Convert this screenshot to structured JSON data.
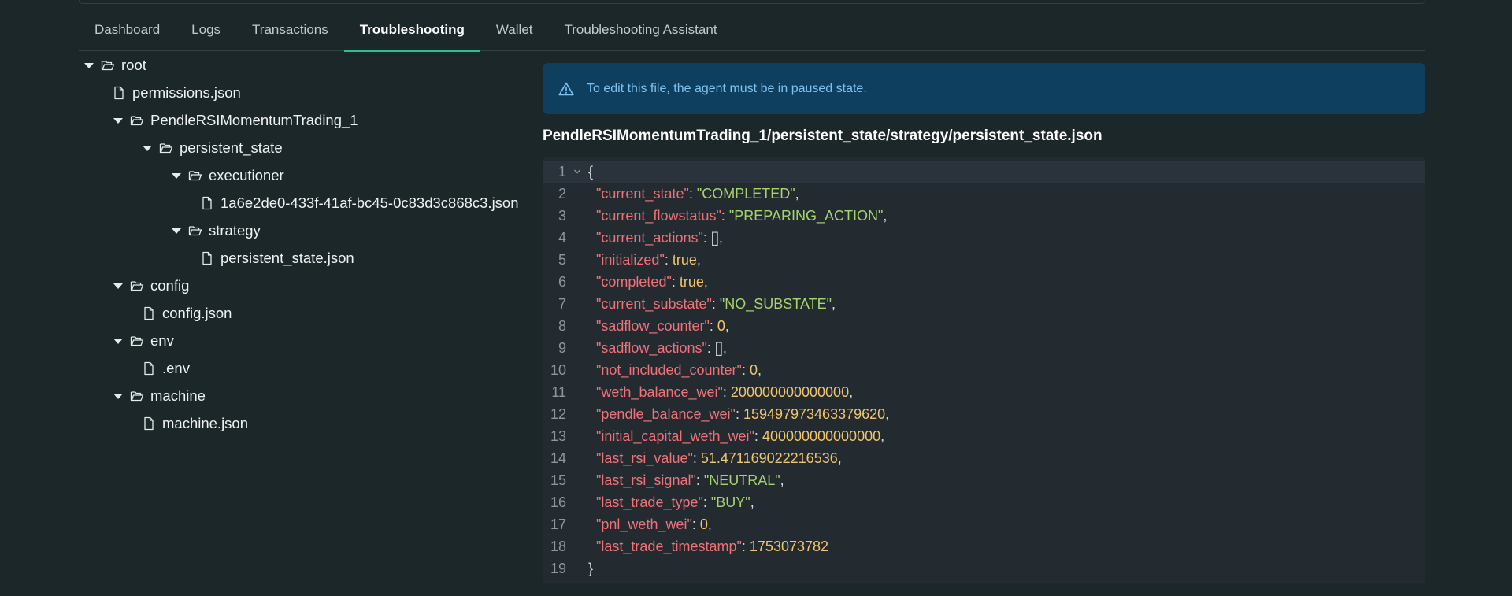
{
  "tabs": [
    {
      "label": "Dashboard",
      "active": false
    },
    {
      "label": "Logs",
      "active": false
    },
    {
      "label": "Transactions",
      "active": false
    },
    {
      "label": "Troubleshooting",
      "active": true
    },
    {
      "label": "Wallet",
      "active": false
    },
    {
      "label": "Troubleshooting Assistant",
      "active": false
    }
  ],
  "tree": {
    "root": "root",
    "permissions": "permissions.json",
    "agent_folder": "PendleRSIMomentumTrading_1",
    "persistent_state": "persistent_state",
    "executioner": "executioner",
    "executioner_file": "1a6e2de0-433f-41af-bc45-0c83d3c868c3.json",
    "strategy": "strategy",
    "strategy_file": "persistent_state.json",
    "config": "config",
    "config_file": "config.json",
    "env": "env",
    "env_file": ".env",
    "machine": "machine",
    "machine_file": "machine.json"
  },
  "alert": {
    "message": "To edit this file, the agent must be in paused state."
  },
  "file_path": "PendleRSIMomentumTrading_1/persistent_state/strategy/persistent_state.json",
  "editor": {
    "line_numbers": [
      "1",
      "2",
      "3",
      "4",
      "5",
      "6",
      "7",
      "8",
      "9",
      "10",
      "11",
      "12",
      "13",
      "14",
      "15",
      "16",
      "17",
      "18",
      "19"
    ],
    "open_brace": "{",
    "close_brace": "}",
    "entries": [
      {
        "key": "\"current_state\"",
        "value": "\"COMPLETED\"",
        "type": "string"
      },
      {
        "key": "\"current_flowstatus\"",
        "value": "\"PREPARING_ACTION\"",
        "type": "string"
      },
      {
        "key": "\"current_actions\"",
        "value": "[]",
        "type": "punct"
      },
      {
        "key": "\"initialized\"",
        "value": "true",
        "type": "number"
      },
      {
        "key": "\"completed\"",
        "value": "true",
        "type": "number"
      },
      {
        "key": "\"current_substate\"",
        "value": "\"NO_SUBSTATE\"",
        "type": "string"
      },
      {
        "key": "\"sadflow_counter\"",
        "value": "0",
        "type": "number"
      },
      {
        "key": "\"sadflow_actions\"",
        "value": "[]",
        "type": "punct"
      },
      {
        "key": "\"not_included_counter\"",
        "value": "0",
        "type": "number"
      },
      {
        "key": "\"weth_balance_wei\"",
        "value": "200000000000000",
        "type": "number"
      },
      {
        "key": "\"pendle_balance_wei\"",
        "value": "159497973463379620",
        "type": "number"
      },
      {
        "key": "\"initial_capital_weth_wei\"",
        "value": "400000000000000",
        "type": "number"
      },
      {
        "key": "\"last_rsi_value\"",
        "value": "51.471169022216536",
        "type": "number"
      },
      {
        "key": "\"last_rsi_signal\"",
        "value": "\"NEUTRAL\"",
        "type": "string"
      },
      {
        "key": "\"last_trade_type\"",
        "value": "\"BUY\"",
        "type": "string"
      },
      {
        "key": "\"pnl_weth_wei\"",
        "value": "0",
        "type": "number"
      },
      {
        "key": "\"last_trade_timestamp\"",
        "value": "1753073782",
        "type": "number"
      }
    ]
  },
  "colors": {
    "accent": "#2fbf8b",
    "alert_bg": "#0f3f5e",
    "alert_text": "#7ec3f0",
    "json_key": "#f07178",
    "json_string": "#a6d46d",
    "json_number": "#f2c56b"
  },
  "icons": {
    "folder": "folder-open-icon",
    "file": "file-icon",
    "caret": "caret-down-icon",
    "alert": "warning-triangle-icon",
    "fold": "chevron-down-icon"
  }
}
